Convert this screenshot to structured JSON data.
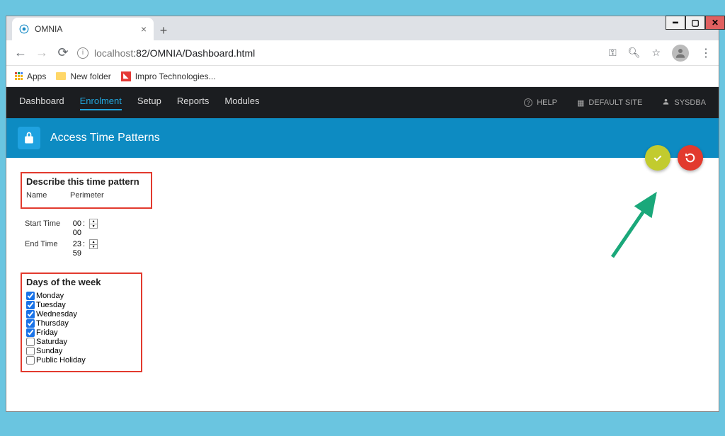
{
  "window": {
    "tab_title": "OMNIA"
  },
  "address": {
    "host": "localhost",
    "port_path": ":82/OMNIA/Dashboard.html"
  },
  "bookmarks": {
    "apps": "Apps",
    "newfolder": "New folder",
    "impro": "Impro Technologies..."
  },
  "topnav": {
    "items": [
      {
        "label": "Dashboard"
      },
      {
        "label": "Enrolment"
      },
      {
        "label": "Setup"
      },
      {
        "label": "Reports"
      },
      {
        "label": "Modules"
      }
    ],
    "active_index": 1,
    "help": "HELP",
    "default_site": "DEFAULT SITE",
    "user": "SYSDBA"
  },
  "page": {
    "title": "Access Time Patterns"
  },
  "describe": {
    "heading": "Describe this time pattern",
    "name_label": "Name",
    "name_value": "Perimeter",
    "start_label": "Start Time",
    "start_h": "00",
    "start_m": "00",
    "end_label": "End Time",
    "end_h": "23",
    "end_m": "59"
  },
  "days": {
    "heading": "Days of the week",
    "items": [
      {
        "label": "Monday",
        "checked": true
      },
      {
        "label": "Tuesday",
        "checked": true
      },
      {
        "label": "Wednesday",
        "checked": true
      },
      {
        "label": "Thursday",
        "checked": true
      },
      {
        "label": "Friday",
        "checked": true
      },
      {
        "label": "Saturday",
        "checked": false
      },
      {
        "label": "Sunday",
        "checked": false
      },
      {
        "label": "Public Holiday",
        "checked": false
      }
    ]
  },
  "colors": {
    "accent": "#0d8bc2",
    "fab_save": "#c2cb2e",
    "fab_cancel": "#e23a2e",
    "arrow": "#1aa87a"
  }
}
